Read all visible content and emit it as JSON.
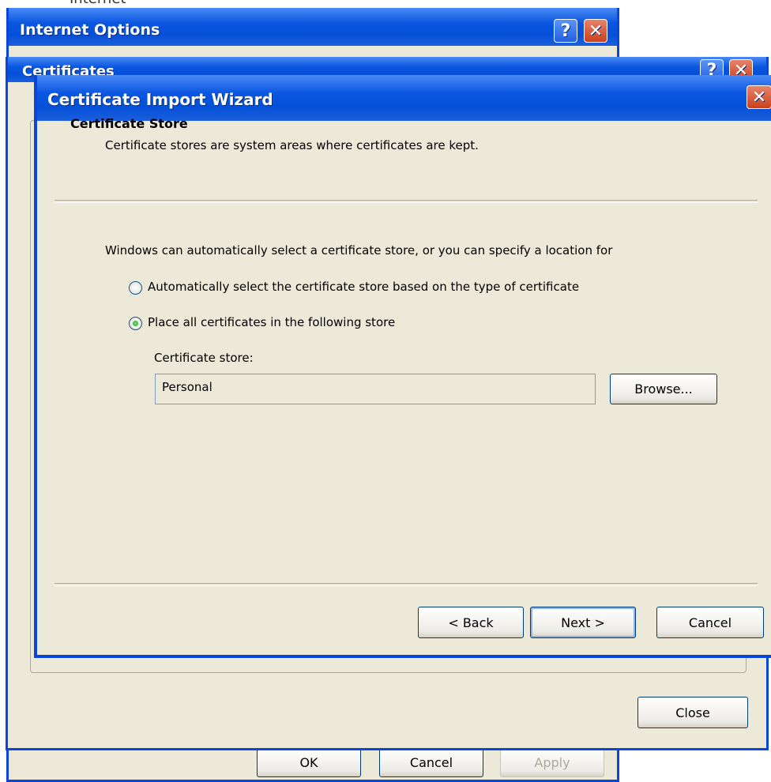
{
  "background": {
    "partial_text": "Internet"
  },
  "internet_options": {
    "title": "Internet Options",
    "buttons": {
      "ok": "OK",
      "cancel": "Cancel",
      "apply": "Apply"
    }
  },
  "certificates": {
    "title": "Certificates",
    "close_label": "Close"
  },
  "wizard": {
    "title": "Certificate Import Wizard",
    "header_title": "Certificate Store",
    "header_subtitle": "Certificate stores are system areas where certificates are kept.",
    "intro": "Windows can automatically select a certificate store, or you can specify a location for",
    "options": [
      {
        "label": "Automatically select the certificate store based on the type of certificate",
        "selected": false
      },
      {
        "label": "Place all certificates in the following store",
        "selected": true
      }
    ],
    "store_label": "Certificate store:",
    "store_value": "Personal",
    "browse_label": "Browse...",
    "back_label": "< Back",
    "next_label": "Next >",
    "cancel_label": "Cancel"
  },
  "titlebar_icons": {
    "help": "?",
    "close": "✕"
  }
}
